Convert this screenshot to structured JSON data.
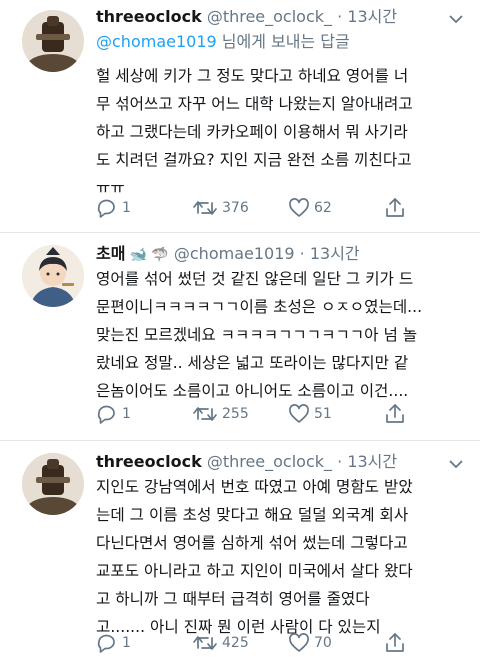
{
  "tweets": [
    {
      "name": "threeoclock",
      "handle": "@three_oclock_",
      "dot": "·",
      "time": "13시간",
      "reply_mention": "@chomae1019",
      "reply_suffix": " 님에게 보내는 답글",
      "lines": [
        "헐 세상에 키가 그 정도 맞다고 하네요 영어를 너",
        "무 섞어쓰고 자꾸 어느 대학 나왔는지 알아내려고",
        "하고 그랬다는데 카카오페이 이용해서 뭐 사기라",
        "도 치려던 걸까요? 지인 지금 완전 소름 끼친다고",
        "ㅠㅠ"
      ],
      "replies": "1",
      "retweets": "376",
      "likes": "62"
    },
    {
      "name": "초매",
      "emojis": "🐋 🦈",
      "handle": "@chomae1019",
      "dot": "·",
      "time": "13시간",
      "lines": [
        "영어를 섞어 썼던 것 같진 않은데 일단 그 키가 드",
        "문편이니ㅋㅋㅋㅋㄱㄱ이름 초성은 ㅇㅈㅇ였는데...",
        "맞는진 모르겠네요 ㅋㅋㅋㅋㄱㄱㄱㅋㄱㄱ아 넘 놀",
        "랐네요 정말.. 세상은 넓고 또라이는 많다지만 같",
        "은놈이어도 소름이고 아니어도 소름이고 이건...."
      ],
      "replies": "1",
      "retweets": "255",
      "likes": "51"
    },
    {
      "name": "threeoclock",
      "handle": "@three_oclock_",
      "dot": "·",
      "time": "13시간",
      "lines": [
        "지인도 강남역에서 번호 따였고 아예 명함도 받았",
        "는데 그 이름 초성 맞다고 해요 덜덜 외국계 회사",
        "다닌다면서 영어를 심하게 섞어 썼는데 그렇다고",
        "교포도 아니라고 하고 지인이 미국에서 살다 왔다",
        "고 하니까 그 때부터 급격히 영어를 줄였다",
        "고....... 아니 진짜 뭔 이런 사람이 다 있는지"
      ],
      "replies": "1",
      "retweets": "425",
      "likes": "70"
    }
  ],
  "colors": {
    "link": "#1da1f2",
    "muted": "#657786",
    "text": "#14171a",
    "divider": "#e1e8ed"
  }
}
